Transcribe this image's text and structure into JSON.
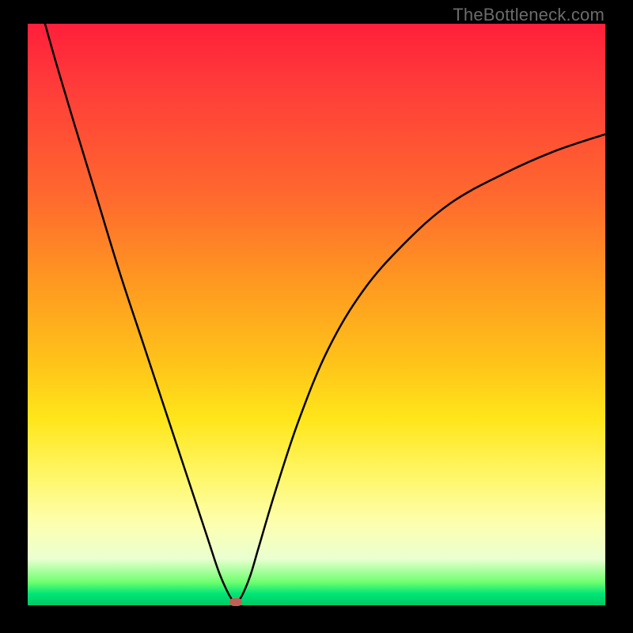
{
  "watermark": "TheBottleneck.com",
  "chart_data": {
    "type": "line",
    "title": "",
    "xlabel": "",
    "ylabel": "",
    "xlim": [
      0,
      100
    ],
    "ylim": [
      0,
      100
    ],
    "series": [
      {
        "name": "left-curve",
        "x": [
          3,
          5,
          8,
          12,
          16,
          20,
          24,
          28,
          31,
          33,
          34.5,
          35.5,
          36
        ],
        "values": [
          100,
          93,
          83,
          70,
          57,
          45,
          33,
          21,
          12,
          6,
          2.5,
          0.8,
          0.5
        ]
      },
      {
        "name": "right-curve",
        "x": [
          36,
          37,
          38.5,
          40,
          43,
          47,
          52,
          58,
          65,
          73,
          82,
          91,
          100
        ],
        "values": [
          0.5,
          1.5,
          5,
          10,
          20,
          32,
          44,
          54,
          62,
          69,
          74,
          78,
          81
        ]
      }
    ],
    "marker": {
      "x": 36,
      "y": 0.5,
      "color": "#c06058"
    },
    "gradient_bands": [
      {
        "y_pct": 0,
        "color": "#ff1f3a"
      },
      {
        "y_pct": 45,
        "color": "#ff9a20"
      },
      {
        "y_pct": 78,
        "color": "#fdffb0"
      },
      {
        "y_pct": 97,
        "color": "#00e676"
      },
      {
        "y_pct": 100,
        "color": "#00c864"
      }
    ]
  },
  "axes_visible": false
}
